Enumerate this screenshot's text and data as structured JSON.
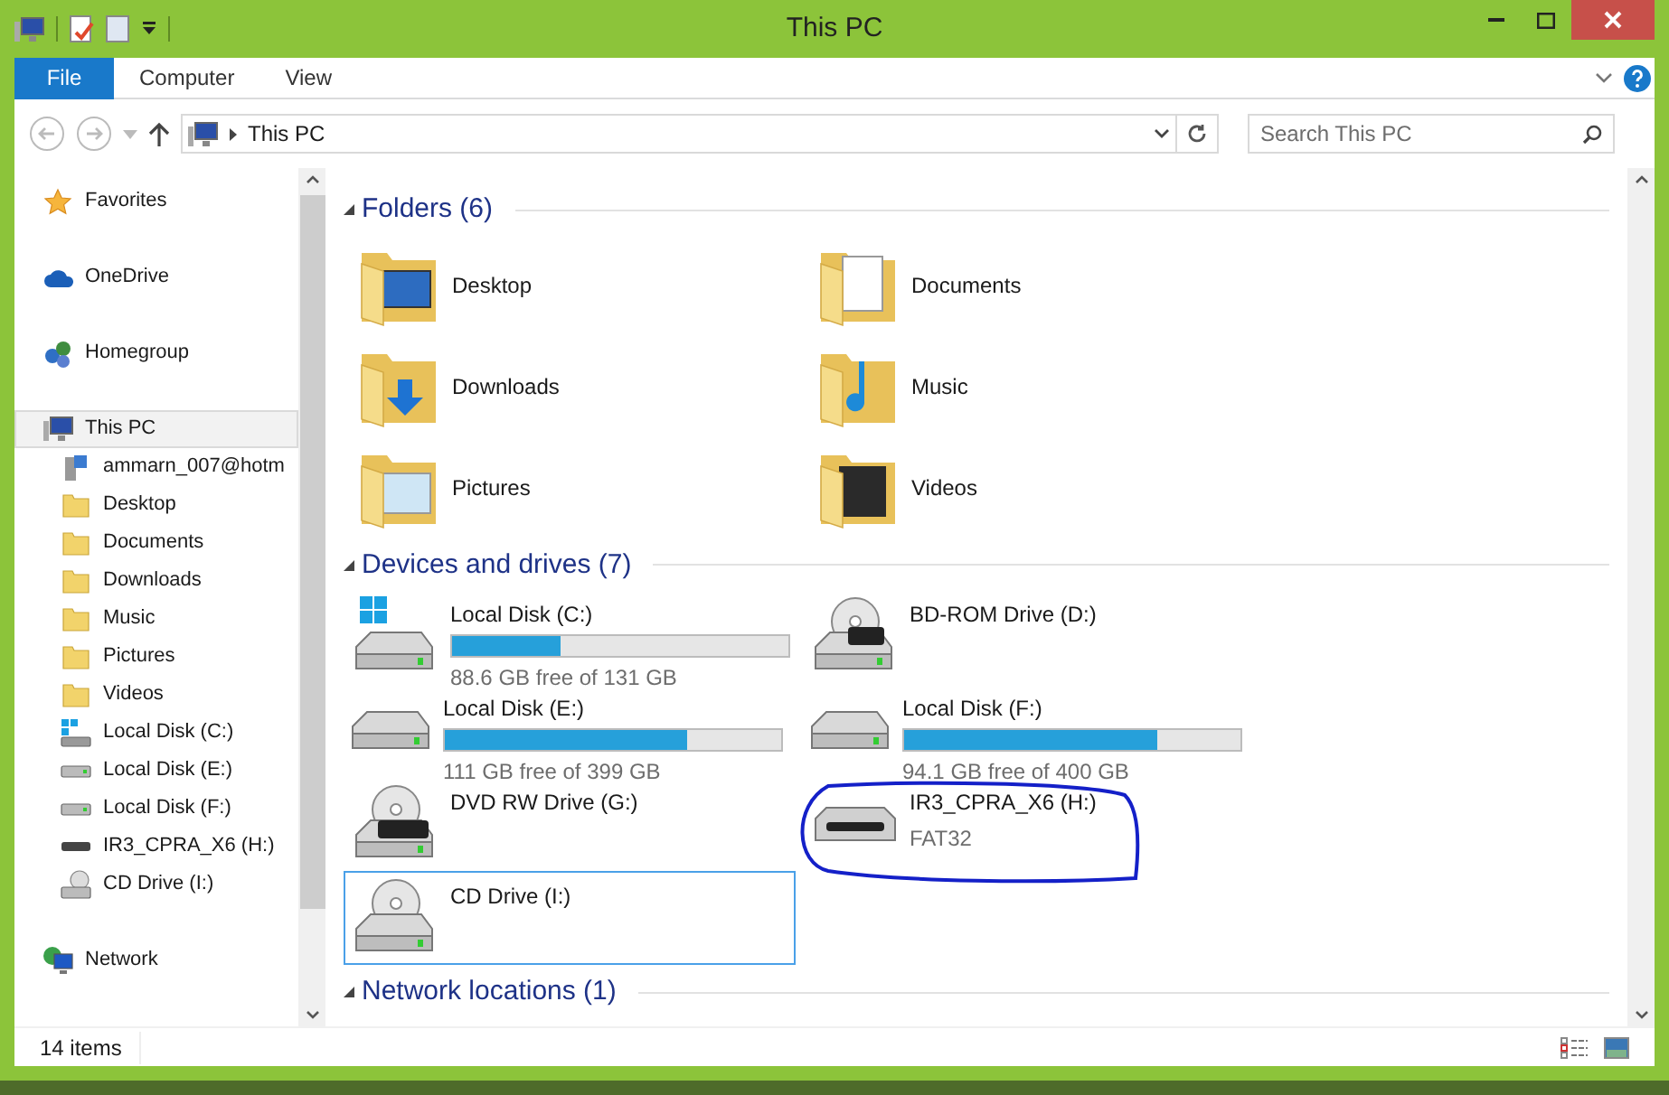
{
  "window": {
    "title": "This PC"
  },
  "ribbon": {
    "tabs": [
      {
        "label": "File",
        "kind": "file"
      },
      {
        "label": "Computer",
        "kind": "tab"
      },
      {
        "label": "View",
        "kind": "tab"
      }
    ]
  },
  "address": {
    "path": "This PC",
    "search_placeholder": "Search This PC"
  },
  "nav": {
    "groups": [
      {
        "label": "Favorites",
        "kind": "star",
        "selected": false
      },
      {
        "label": "OneDrive",
        "kind": "cloud",
        "selected": false
      },
      {
        "label": "Homegroup",
        "kind": "homegroup",
        "selected": false
      },
      {
        "label": "This PC",
        "kind": "pc",
        "selected": true,
        "children": [
          {
            "label": "ammarn_007@hotm",
            "kind": "user",
            "selected": false
          },
          {
            "label": "Desktop",
            "kind": "folder",
            "selected": false
          },
          {
            "label": "Documents",
            "kind": "folder",
            "selected": false
          },
          {
            "label": "Downloads",
            "kind": "folder",
            "selected": false
          },
          {
            "label": "Music",
            "kind": "folder",
            "selected": false
          },
          {
            "label": "Pictures",
            "kind": "folder",
            "selected": false
          },
          {
            "label": "Videos",
            "kind": "folder",
            "selected": false
          },
          {
            "label": "Local Disk (C:)",
            "kind": "sysdisk",
            "selected": false
          },
          {
            "label": "Local Disk (E:)",
            "kind": "disk",
            "selected": false
          },
          {
            "label": "Local Disk (F:)",
            "kind": "disk",
            "selected": false
          },
          {
            "label": "IR3_CPRA_X6 (H:)",
            "kind": "usb",
            "selected": false
          },
          {
            "label": "CD Drive (I:)",
            "kind": "cd",
            "selected": false
          }
        ]
      },
      {
        "label": "Network",
        "kind": "network",
        "selected": false
      }
    ]
  },
  "folders": {
    "title": "Folders (6)",
    "items": [
      {
        "name": "Desktop",
        "kind": "desktop"
      },
      {
        "name": "Documents",
        "kind": "documents"
      },
      {
        "name": "Downloads",
        "kind": "downloads"
      },
      {
        "name": "Music",
        "kind": "music"
      },
      {
        "name": "Pictures",
        "kind": "pictures"
      },
      {
        "name": "Videos",
        "kind": "videos"
      }
    ]
  },
  "devices": {
    "title": "Devices and drives (7)",
    "items": [
      {
        "name": "Local Disk (C:)",
        "kind": "sysdisk",
        "level": 0.32,
        "free": "88.6 GB free of 131 GB",
        "selected": false
      },
      {
        "name": "BD-ROM Drive (D:)",
        "kind": "bd",
        "selected": false
      },
      {
        "name": "Local Disk (E:)",
        "kind": "disk",
        "level": 0.72,
        "free": "111 GB free of 399 GB",
        "selected": false
      },
      {
        "name": "Local Disk (F:)",
        "kind": "disk",
        "level": 0.75,
        "free": "94.1 GB free of 400 GB",
        "selected": false
      },
      {
        "name": "DVD RW Drive (G:)",
        "kind": "dvd",
        "selected": false
      },
      {
        "name": "IR3_CPRA_X6 (H:)",
        "kind": "usb",
        "detail": "FAT32",
        "circled": true,
        "selected": false
      },
      {
        "name": "CD Drive (I:)",
        "kind": "cd",
        "selected": true
      }
    ]
  },
  "network": {
    "title": "Network locations (1)"
  },
  "status_bar": {
    "count": "14 items"
  }
}
